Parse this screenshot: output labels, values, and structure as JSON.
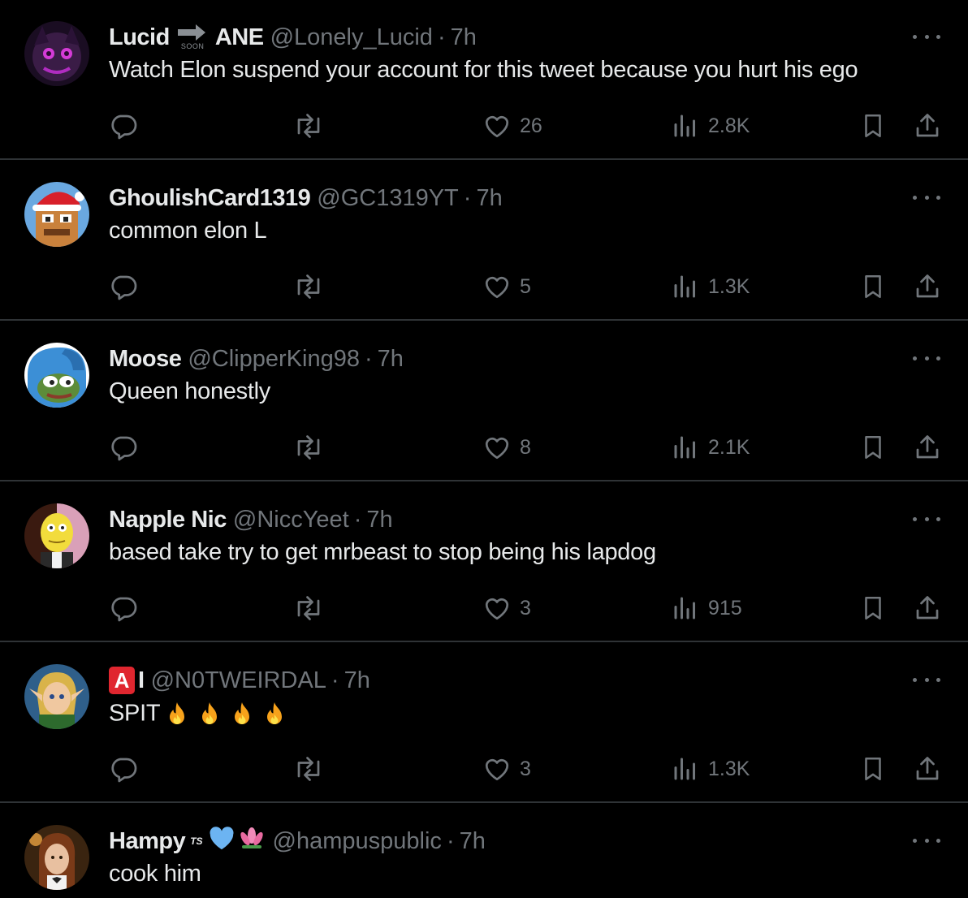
{
  "colors": {
    "background": "#000000",
    "text_primary": "#e7e9ea",
    "text_secondary": "#71767b",
    "divider": "#2f3336"
  },
  "tweets": [
    {
      "name_part1": "Lucid",
      "name_badge_small_text": "SOON",
      "name_part2": "ANE",
      "handle": "@Lonely_Lucid",
      "dot": "·",
      "time": "7h",
      "text": "Watch Elon suspend your account for this tweet because you hurt his ego",
      "likes": "26",
      "views": "2.8K"
    },
    {
      "name": "GhoulishCard1319",
      "handle": "@GC1319YT",
      "dot": "·",
      "time": "7h",
      "text": "common elon L",
      "likes": "5",
      "views": "1.3K"
    },
    {
      "name": "Moose",
      "handle": "@ClipperKing98",
      "dot": "·",
      "time": "7h",
      "text": "Queen honestly",
      "likes": "8",
      "views": "2.1K"
    },
    {
      "name": "Napple Nic",
      "handle": "@NiccYeet",
      "dot": "·",
      "time": "7h",
      "text": "based take try to get mrbeast to stop being his lapdog",
      "likes": "3",
      "views": "915"
    },
    {
      "name_badge": "A",
      "name": "I",
      "handle": "@N0TWEIRDAL",
      "dot": "·",
      "time": "7h",
      "text": "SPIT",
      "text_emoji_count": 4,
      "likes": "3",
      "views": "1.3K"
    },
    {
      "name": "Hampy",
      "name_sup": "TS",
      "handle": "@hampuspublic",
      "dot": "·",
      "time": "7h",
      "text": "cook him"
    }
  ],
  "icons": {
    "reply": "reply-icon",
    "retweet": "retweet-icon",
    "like": "heart-icon",
    "views": "views-chart-icon",
    "bookmark": "bookmark-icon",
    "share": "share-icon",
    "more": "more-options-icon"
  }
}
